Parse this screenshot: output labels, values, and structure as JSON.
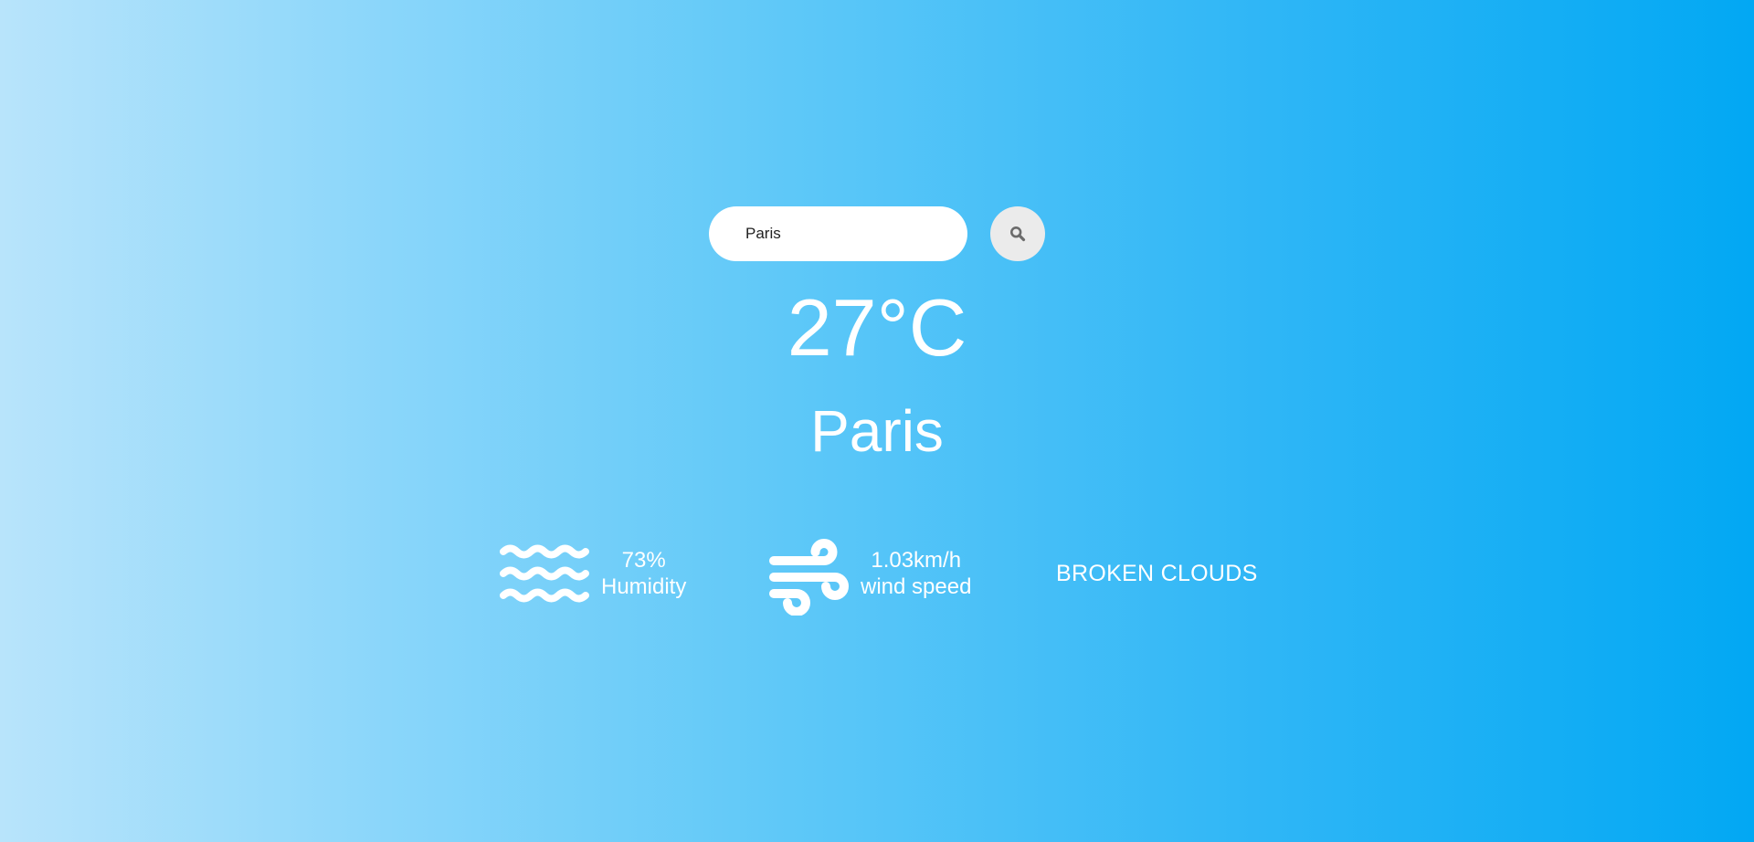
{
  "search": {
    "value": "Paris",
    "button_icon": "search-icon"
  },
  "weather": {
    "temperature": "27°C",
    "city": "Paris",
    "humidity_value": "73%",
    "humidity_label": "Humidity",
    "humidity_icon": "water-waves-icon",
    "wind_value": "1.03km/h",
    "wind_label": "wind speed",
    "wind_icon": "wind-icon",
    "description": "BROKEN CLOUDS"
  },
  "colors": {
    "gradient_start": "#b8e4fb",
    "gradient_end": "#02a8f3",
    "text": "#ffffff",
    "search_button_bg": "#ebebeb",
    "search_icon": "#6b6b6b"
  }
}
